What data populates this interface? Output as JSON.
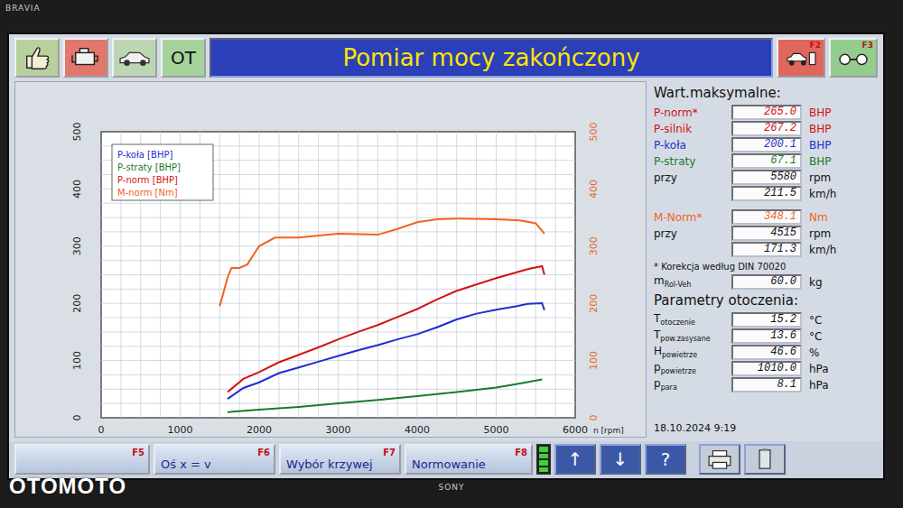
{
  "monitor": {
    "brand": "BRAVIA",
    "maker": "SONY"
  },
  "watermark": "OTOMOTO",
  "toolbar": {
    "left": [
      {
        "kind": "thumb",
        "color": "#b8d09e"
      },
      {
        "kind": "engine",
        "color": "#e2776b"
      },
      {
        "kind": "car",
        "color": "#bcd5b2"
      },
      {
        "kind": "text",
        "label": "OT",
        "color": "#a6d39c"
      }
    ],
    "right": [
      {
        "kind": "brake",
        "key": "F2",
        "color": "#e0675b"
      },
      {
        "kind": "roller",
        "key": "F3",
        "color": "#93cc8c"
      }
    ]
  },
  "window": {
    "title": "Pomiar mocy zakończony"
  },
  "chart": {
    "y_ticks": [
      "0",
      "100",
      "200",
      "300",
      "400",
      "500"
    ],
    "y2_ticks": [
      "0",
      "100",
      "200",
      "300",
      "400",
      "500"
    ],
    "x_ticks": [
      "0",
      "1000",
      "2000",
      "3000",
      "4000",
      "5000",
      "6000"
    ],
    "x_label": "n [rpm]",
    "series": [
      {
        "name": "P-koła [BHP]",
        "color": "#1e2ed0",
        "rpm": [
          1600,
          1800,
          2000,
          2250,
          2500,
          2750,
          3000,
          3250,
          3500,
          3750,
          4000,
          4250,
          4500,
          4750,
          5000,
          5250,
          5400,
          5580,
          5610
        ],
        "values": [
          33,
          52,
          62,
          78,
          88,
          98,
          108,
          118,
          127,
          137,
          146,
          158,
          172,
          182,
          189,
          195,
          199,
          200.1,
          188
        ]
      },
      {
        "name": "P-straty [BHP]",
        "color": "#1a7a2a",
        "rpm": [
          1600,
          2000,
          2500,
          3000,
          3500,
          4000,
          4500,
          5000,
          5300,
          5580
        ],
        "values": [
          10,
          14,
          19,
          25,
          31,
          38,
          45,
          53,
          60,
          67.1
        ]
      },
      {
        "name": "P-norm [BHP]",
        "color": "#d21414",
        "rpm": [
          1600,
          1800,
          2000,
          2250,
          2500,
          2750,
          3000,
          3250,
          3500,
          3750,
          4000,
          4250,
          4500,
          4750,
          5000,
          5250,
          5400,
          5580,
          5610
        ],
        "values": [
          45,
          68,
          80,
          97,
          110,
          123,
          137,
          150,
          162,
          176,
          190,
          207,
          222,
          233,
          244,
          254,
          260,
          265,
          250
        ]
      },
      {
        "name": "M-norm [Nm]",
        "color": "#f0641e",
        "rpm": [
          1500,
          1600,
          1650,
          1750,
          1850,
          2000,
          2200,
          2500,
          3000,
          3500,
          3750,
          4000,
          4250,
          4515,
          5000,
          5300,
          5500,
          5610
        ],
        "values": [
          195,
          245,
          262,
          262,
          268,
          300,
          315,
          315,
          322,
          320,
          330,
          342,
          347,
          348.1,
          347,
          345,
          340,
          322
        ]
      }
    ]
  },
  "max_title": "Wart.maksymalne:",
  "max_rows": [
    {
      "label": "P-norm*",
      "value": "265.0",
      "unit": "BHP",
      "color": "#d01010"
    },
    {
      "label": "P-silnik",
      "value": "267.2",
      "unit": "BHP",
      "color": "#d01010"
    },
    {
      "label": "P-koła",
      "value": "200.1",
      "unit": "BHP",
      "color": "#1e2ed0"
    },
    {
      "label": "P-straty",
      "value": "67.1",
      "unit": "BHP",
      "color": "#1a7a2a"
    },
    {
      "label": "przy",
      "value": "5580",
      "unit": "rpm",
      "color": "#111111"
    },
    {
      "label": "",
      "value": "211.5",
      "unit": "km/h",
      "color": "#111111"
    }
  ],
  "torque_rows": [
    {
      "label": "M-Norm*",
      "value": "348.1",
      "unit": "Nm",
      "color": "#f0641e"
    },
    {
      "label": "przy",
      "value": "4515",
      "unit": "rpm",
      "color": "#111111"
    },
    {
      "label": "",
      "value": "171.3",
      "unit": "km/h",
      "color": "#111111"
    }
  ],
  "note": "* Korekcja według DIN 70020",
  "mass": {
    "label": "m",
    "sub": "Rol-Veh",
    "value": "60.0",
    "unit": "kg"
  },
  "env_title": "Parametry otoczenia:",
  "env_rows": [
    {
      "label": "T",
      "sub": "otoczenie",
      "value": "15.2",
      "unit": "°C"
    },
    {
      "label": "T",
      "sub": "pow.zasysane",
      "value": "13.6",
      "unit": "°C"
    },
    {
      "label": "H",
      "sub": "powietrze",
      "value": "46.6",
      "unit": "%"
    },
    {
      "label": "p",
      "sub": "powietrze",
      "value": "1010.0",
      "unit": "hPa"
    },
    {
      "label": "p",
      "sub": "para",
      "value": "8.1",
      "unit": "hPa"
    }
  ],
  "datetime": "18.10.2024   9:19",
  "bottom_buttons": [
    {
      "key": "F5"
    },
    {
      "key": "F6",
      "label": "Oś x = v"
    },
    {
      "key": "F7",
      "label": "Wybór krzywej"
    },
    {
      "key": "F8",
      "label": "Normowanie"
    }
  ],
  "indicator": {
    "on": true
  },
  "icon_buttons": [
    {
      "kind": "text",
      "label": "↑"
    },
    {
      "kind": "text",
      "label": "↓"
    },
    {
      "kind": "text",
      "label": "?"
    },
    {
      "kind": "printer"
    },
    {
      "kind": "document"
    }
  ]
}
